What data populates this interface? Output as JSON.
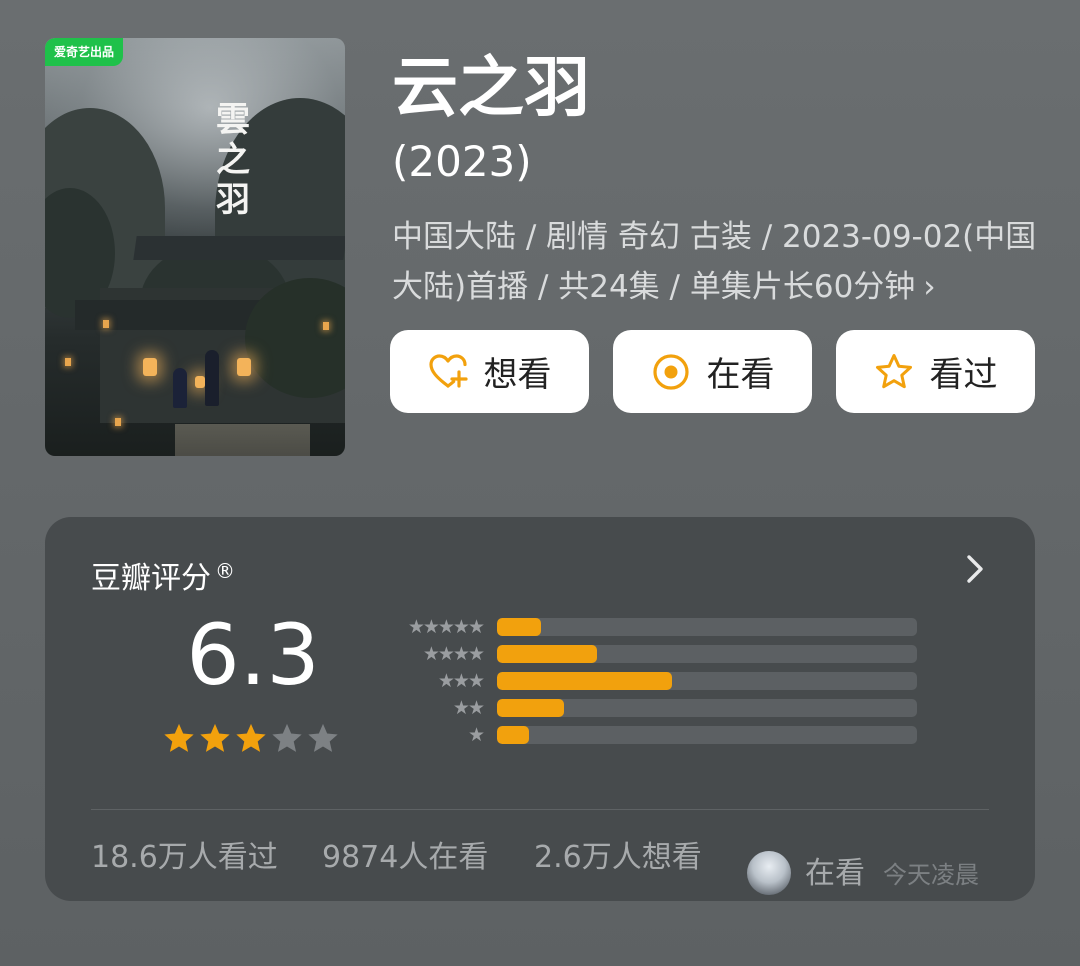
{
  "poster": {
    "logo_text": "爱奇艺出品",
    "calligraphy": [
      "雲",
      "之",
      "羽"
    ]
  },
  "title": "云之羽",
  "year": "(2023)",
  "meta_text": "中国大陆 / 剧情 奇幻 古装 / 2023-09-02(中国大陆)首播 / 共24集 / 单集片长60分钟",
  "meta_chevron": "›",
  "actions": [
    {
      "label": "想看",
      "icon": "heart-plus-icon"
    },
    {
      "label": "在看",
      "icon": "target-circle-icon"
    },
    {
      "label": "看过",
      "icon": "star-outline-icon"
    }
  ],
  "rating": {
    "title": "豆瓣评分",
    "registered_mark": "®",
    "score": "6.3",
    "stars_filled": 3,
    "stars_total": 5,
    "distribution": [
      {
        "stars": 5,
        "fraction": 0.105
      },
      {
        "stars": 4,
        "fraction": 0.238
      },
      {
        "stars": 3,
        "fraction": 0.417
      },
      {
        "stars": 2,
        "fraction": 0.16
      },
      {
        "stars": 1,
        "fraction": 0.075
      }
    ],
    "stats": {
      "watched": "18.6万人看过",
      "watching": "9874人在看",
      "want": "2.6万人想看"
    },
    "friend": {
      "status": "在看",
      "time": "今天凌晨"
    }
  },
  "colors": {
    "accent": "#f2a10d",
    "panel": "#474b4d",
    "background": "#646869"
  }
}
